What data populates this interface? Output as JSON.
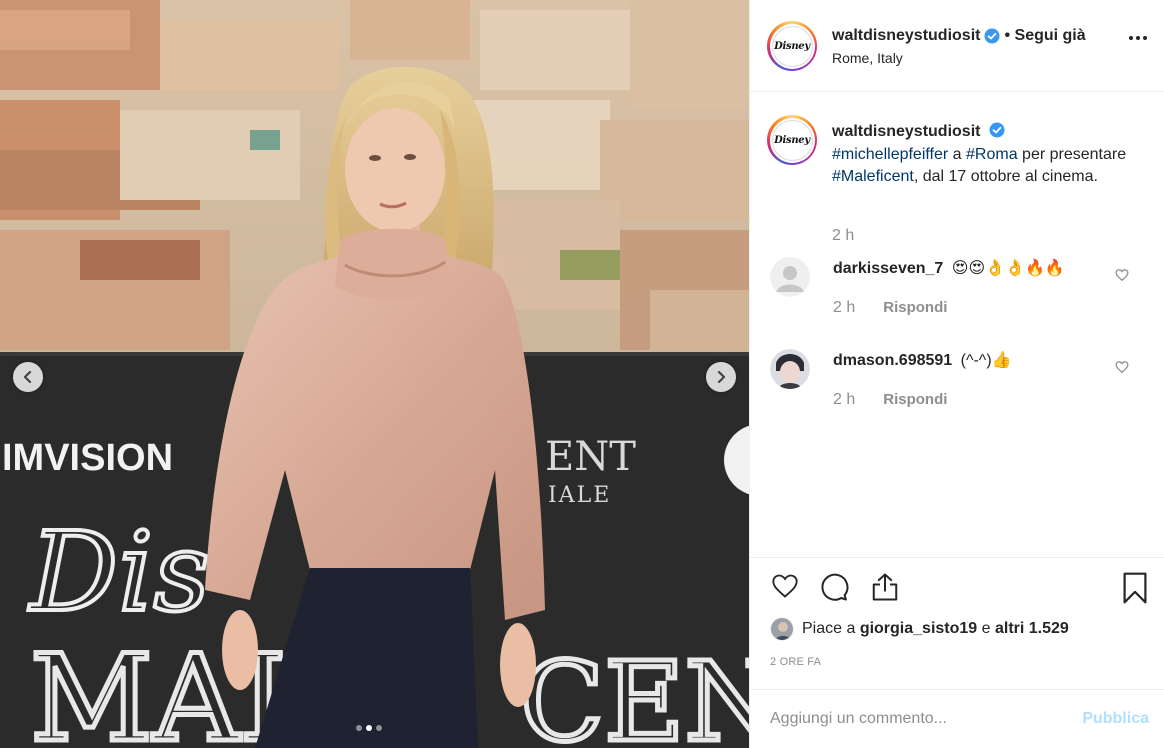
{
  "post": {
    "media_alt": "Photo of a woman in a pink satin blouse at a Maleficent photocall in Rome",
    "banner_texts": [
      "IMVISION",
      "Disney",
      "MALEFICENT",
      "ENT",
      "IALE"
    ],
    "carousel": {
      "count": 3,
      "active": 1
    }
  },
  "header": {
    "username": "waltdisneystudiosit",
    "follow_status": "• Segui già",
    "location": "Rome, Italy",
    "avatar_text": "Disney"
  },
  "caption": {
    "username": "waltdisneystudiosit",
    "tag1": "#michellepfeiffer",
    "text1": " a ",
    "tag2": "#Roma",
    "text2": " per presentare ",
    "tag3": "#Maleficent",
    "text3": ", dal 17 ottobre al cinema.",
    "time": "2 h"
  },
  "comments": [
    {
      "username": "darkisseven_7",
      "text": "😍😍👌👌🔥🔥",
      "time": "2 h",
      "reply_label": "Rispondi"
    },
    {
      "username": "dmason.698591",
      "text": "(^-^)👍",
      "time": "2 h",
      "reply_label": "Rispondi"
    }
  ],
  "likes": {
    "prefix": "Piace a ",
    "user": "giorgia_sisto19",
    "middle": " e ",
    "others": "altri 1.529"
  },
  "time_ago": "2 ORE FA",
  "add_comment": {
    "placeholder": "Aggiungi un commento...",
    "publish_label": "Pubblica"
  },
  "colors": {
    "link": "#00376b",
    "verified": "#3897f0",
    "publish_disabled": "#b2dffc",
    "muted": "#8e8e8e"
  },
  "icons": [
    "chevron-left-icon",
    "chevron-right-icon",
    "more-icon",
    "verified-icon",
    "heart-icon",
    "comment-icon",
    "share-icon",
    "bookmark-icon"
  ]
}
